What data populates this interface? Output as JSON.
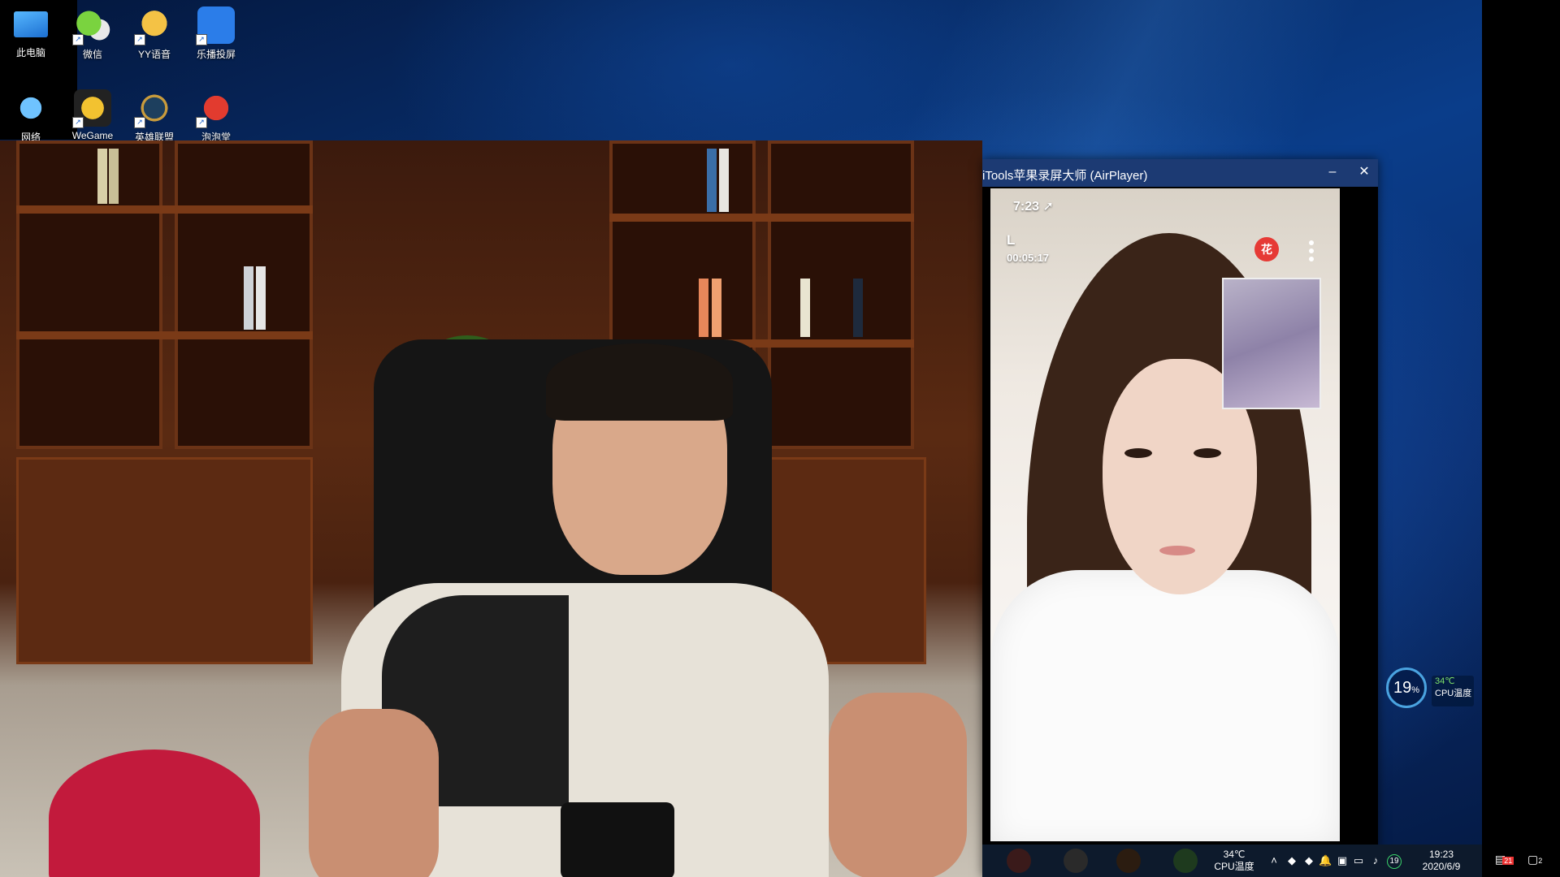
{
  "desktop": {
    "icons": [
      {
        "label": "此电脑",
        "icon": "computer-icon"
      },
      {
        "label": "微信",
        "icon": "wechat-icon"
      },
      {
        "label": "YY语音",
        "icon": "yy-icon"
      },
      {
        "label": "乐播投屏",
        "icon": "lebo-icon"
      },
      {
        "label": "网络",
        "icon": "network-icon"
      },
      {
        "label": "WeGame",
        "icon": "wegame-icon"
      },
      {
        "label": "英雄联盟",
        "icon": "lol-icon"
      },
      {
        "label": "泡泡堂",
        "icon": "paopaotang-icon"
      }
    ]
  },
  "airplayer": {
    "title": "iTools苹果录屏大师 (AirPlayer)",
    "minimize": "–",
    "close": "✕",
    "phone": {
      "clock": "7:23 ➚",
      "caller_initial": "L",
      "call_duration": "00:05:17",
      "badge": "花"
    }
  },
  "cpu_widget": {
    "percent": "19",
    "percent_unit": "%",
    "temperature": "34℃",
    "label": "CPU温度"
  },
  "taskbar": {
    "cpu_temp": "34℃",
    "cpu_label": "CPU温度",
    "tray_badge": "19",
    "time": "19:23",
    "date": "2020/6/9",
    "notification_count": "21",
    "action_center_count": "2"
  },
  "colors": {
    "titlebar": "#1c3a73",
    "taskbar": "#0d1a2c",
    "accent": "#4aa3e0"
  }
}
